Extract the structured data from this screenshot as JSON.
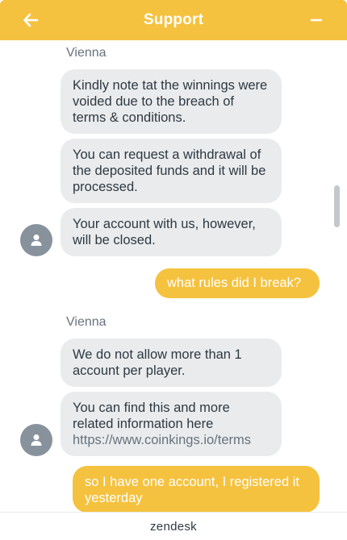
{
  "header": {
    "title": "Support",
    "back_icon": "arrow-left-icon",
    "minimize_icon": "minus-icon",
    "color": "#f5c23f"
  },
  "conversation": {
    "agent_name_1": "Vienna",
    "agent_group_1": [
      "Kindly note tat the winnings were voided due to the breach of terms & conditions.",
      "You can request a withdrawal of the deposited funds and it will be processed.",
      "Your account with us, however, will be closed."
    ],
    "user_message_1": "what rules did I break?",
    "agent_name_2": "Vienna",
    "agent_group_2": [
      "We do not allow more than 1 account per player.",
      "You can find this and more related information here"
    ],
    "agent_link": "https://www.coinkings.io/terms",
    "user_message_2": "so I have one account, I registered it yesterday",
    "avatar_icon": "user-silhouette-icon"
  },
  "footer": {
    "brand": "zendesk"
  }
}
